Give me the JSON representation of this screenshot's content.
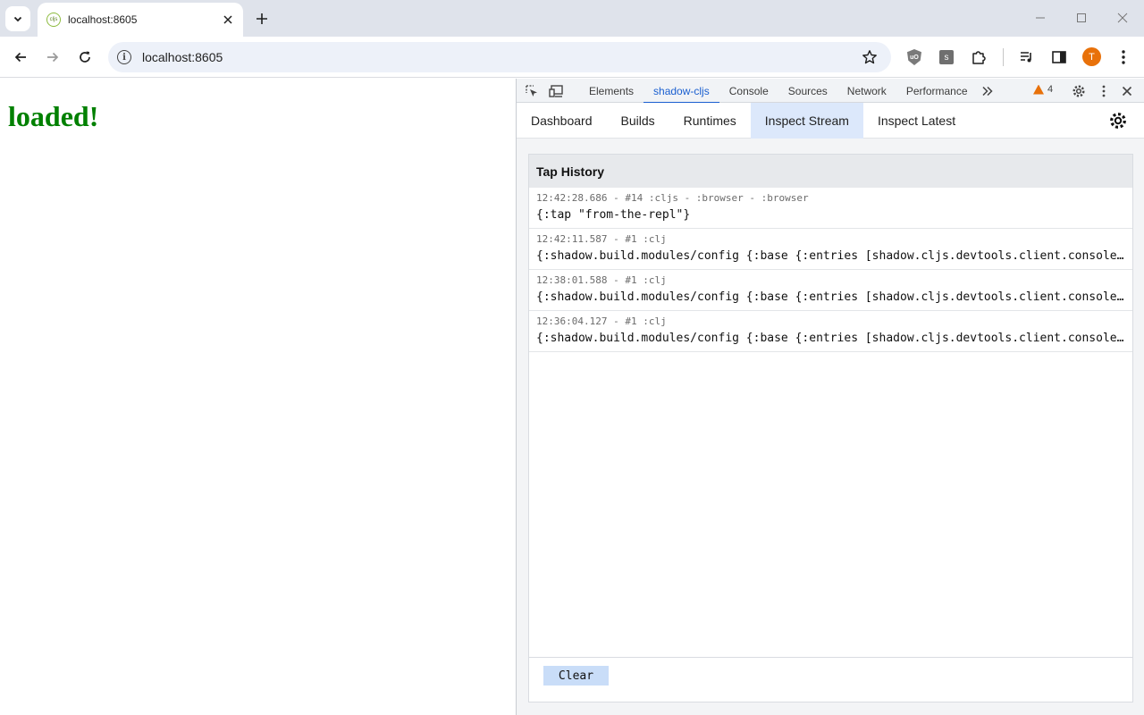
{
  "browser": {
    "tab_title": "localhost:8605",
    "favicon_text": "cljs",
    "url": "localhost:8605",
    "profile_initial": "T",
    "extensions": [
      {
        "name": "ublock-icon",
        "label": "uO"
      },
      {
        "name": "s-extension-icon",
        "label": "s"
      }
    ]
  },
  "page": {
    "heading": "loaded!",
    "heading_color": "#008000"
  },
  "devtools": {
    "tabs": [
      {
        "label": "Elements",
        "active": false
      },
      {
        "label": "shadow-cljs",
        "active": true
      },
      {
        "label": "Console",
        "active": false
      },
      {
        "label": "Sources",
        "active": false
      },
      {
        "label": "Network",
        "active": false
      },
      {
        "label": "Performance",
        "active": false
      }
    ],
    "warning_count": "4",
    "accent": "#1a5fd0"
  },
  "shadow_cljs": {
    "nav": [
      {
        "label": "Dashboard",
        "active": false
      },
      {
        "label": "Builds",
        "active": false
      },
      {
        "label": "Runtimes",
        "active": false
      },
      {
        "label": "Inspect Stream",
        "active": true
      },
      {
        "label": "Inspect Latest",
        "active": false
      }
    ],
    "panel_title": "Tap History",
    "entries": [
      {
        "meta": "12:42:28.686 - #14 :cljs - :browser - :browser",
        "value": "{:tap \"from-the-repl\"}"
      },
      {
        "meta": "12:42:11.587 - #1 :clj",
        "value": "{:shadow.build.modules/config {:base {:entries [shadow.cljs.devtools.client.console shadow.cljs.devtools.client.browser]}}}"
      },
      {
        "meta": "12:38:01.588 - #1 :clj",
        "value": "{:shadow.build.modules/config {:base {:entries [shadow.cljs.devtools.client.console shadow.cljs.devtools.client.browser]}}}"
      },
      {
        "meta": "12:36:04.127 - #1 :clj",
        "value": "{:shadow.build.modules/config {:base {:entries [shadow.cljs.devtools.client.console shadow.cljs.devtools.client.browser]}}}"
      }
    ],
    "clear_label": "Clear"
  }
}
